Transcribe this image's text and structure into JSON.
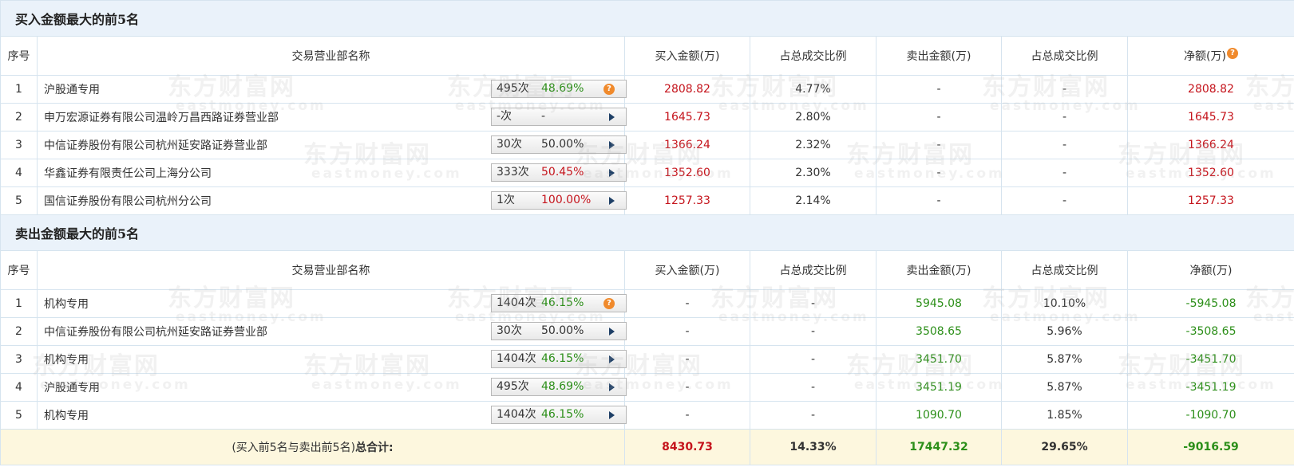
{
  "buy_section": {
    "title": "买入金额最大的前5名",
    "headers": [
      "序号",
      "交易营业部名称",
      "买入金额(万)",
      "占总成交比例",
      "卖出金额(万)",
      "占总成交比例",
      "净额(万)"
    ],
    "rows": [
      {
        "idx": "1",
        "name": "沪股通专用",
        "count": "495次",
        "pct": "48.69%",
        "pct_color": "green",
        "icon": "question",
        "buy": "2808.82",
        "buy_ratio": "4.77%",
        "sell": "-",
        "sell_ratio": "-",
        "net": "2808.82"
      },
      {
        "idx": "2",
        "name": "申万宏源证券有限公司温岭万昌西路证券营业部",
        "count": "-次",
        "pct": "-",
        "pct_color": "gray",
        "icon": "arrow",
        "buy": "1645.73",
        "buy_ratio": "2.80%",
        "sell": "-",
        "sell_ratio": "-",
        "net": "1645.73"
      },
      {
        "idx": "3",
        "name": "中信证券股份有限公司杭州延安路证券营业部",
        "count": "30次",
        "pct": "50.00%",
        "pct_color": "gray",
        "icon": "arrow",
        "buy": "1366.24",
        "buy_ratio": "2.32%",
        "sell": "-",
        "sell_ratio": "-",
        "net": "1366.24"
      },
      {
        "idx": "4",
        "name": "华鑫证券有限责任公司上海分公司",
        "count": "333次",
        "pct": "50.45%",
        "pct_color": "red",
        "icon": "arrow",
        "buy": "1352.60",
        "buy_ratio": "2.30%",
        "sell": "-",
        "sell_ratio": "-",
        "net": "1352.60"
      },
      {
        "idx": "5",
        "name": "国信证券股份有限公司杭州分公司",
        "count": "1次",
        "pct": "100.00%",
        "pct_color": "red",
        "icon": "arrow",
        "buy": "1257.33",
        "buy_ratio": "2.14%",
        "sell": "-",
        "sell_ratio": "-",
        "net": "1257.33"
      }
    ]
  },
  "sell_section": {
    "title": "卖出金额最大的前5名",
    "headers": [
      "序号",
      "交易营业部名称",
      "买入金额(万)",
      "占总成交比例",
      "卖出金额(万)",
      "占总成交比例",
      "净额(万)"
    ],
    "rows": [
      {
        "idx": "1",
        "name": "机构专用",
        "count": "1404次",
        "pct": "46.15%",
        "pct_color": "green",
        "icon": "question",
        "buy": "-",
        "buy_ratio": "-",
        "sell": "5945.08",
        "sell_ratio": "10.10%",
        "net": "-5945.08"
      },
      {
        "idx": "2",
        "name": "中信证券股份有限公司杭州延安路证券营业部",
        "count": "30次",
        "pct": "50.00%",
        "pct_color": "gray",
        "icon": "arrow",
        "buy": "-",
        "buy_ratio": "-",
        "sell": "3508.65",
        "sell_ratio": "5.96%",
        "net": "-3508.65"
      },
      {
        "idx": "3",
        "name": "机构专用",
        "count": "1404次",
        "pct": "46.15%",
        "pct_color": "green",
        "icon": "arrow",
        "buy": "-",
        "buy_ratio": "-",
        "sell": "3451.70",
        "sell_ratio": "5.87%",
        "net": "-3451.70"
      },
      {
        "idx": "4",
        "name": "沪股通专用",
        "count": "495次",
        "pct": "48.69%",
        "pct_color": "green",
        "icon": "arrow",
        "buy": "-",
        "buy_ratio": "-",
        "sell": "3451.19",
        "sell_ratio": "5.87%",
        "net": "-3451.19"
      },
      {
        "idx": "5",
        "name": "机构专用",
        "count": "1404次",
        "pct": "46.15%",
        "pct_color": "green",
        "icon": "arrow",
        "buy": "-",
        "buy_ratio": "-",
        "sell": "1090.70",
        "sell_ratio": "1.85%",
        "net": "-1090.70"
      }
    ]
  },
  "total": {
    "label_prefix": "(买入前5名与卖出前5名)",
    "label_bold": "总合计:",
    "buy": "8430.73",
    "buy_ratio": "14.33%",
    "sell": "17447.32",
    "sell_ratio": "29.65%",
    "net": "-9016.59"
  },
  "watermark": {
    "cn": "东方财富网",
    "en": "eastmoney.com"
  },
  "colors": {
    "red": "#c5141c",
    "green": "#2c8f19",
    "header_bg": "#eaf2fa",
    "total_bg": "#fdf7de",
    "icon_orange": "#f08a2c"
  }
}
